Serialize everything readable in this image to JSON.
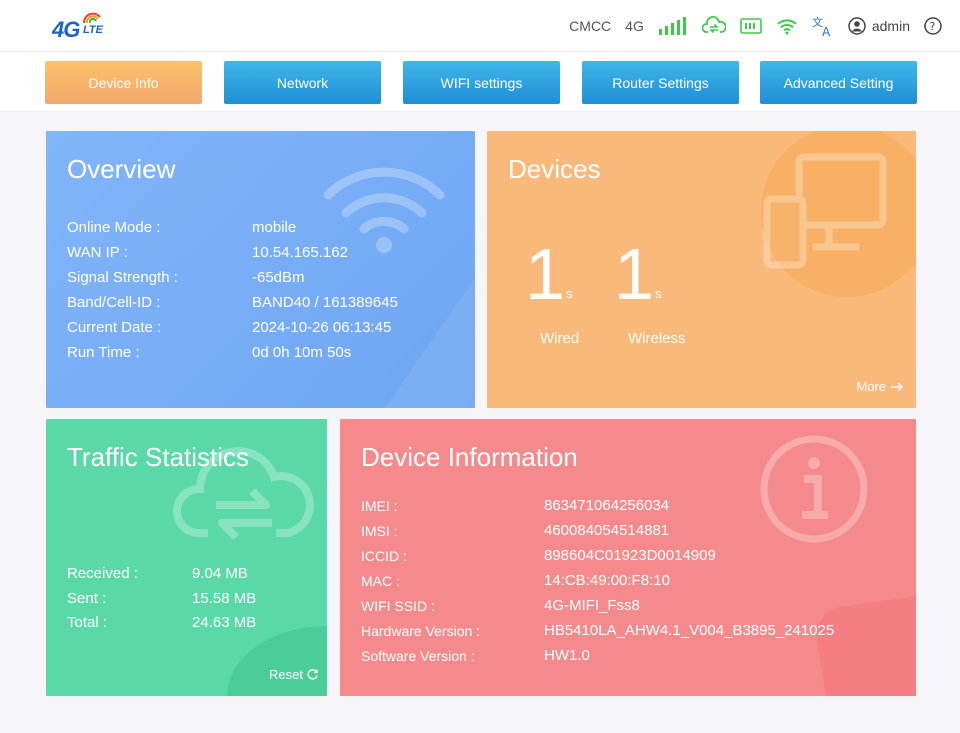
{
  "header": {
    "logo_main": "4G",
    "logo_sub": "LTE",
    "operator": "CMCC",
    "network_type": "4G",
    "icons": [
      "signal-icon",
      "cloud-sync-icon",
      "sim-card-icon",
      "wifi-icon",
      "translate-icon",
      "user-icon",
      "help-icon"
    ],
    "user": "admin",
    "colors": {
      "status_green": "#3ec84a",
      "translate_blue": "#2f6fd6"
    }
  },
  "nav": {
    "tabs": [
      {
        "label": "Device Info",
        "active": true
      },
      {
        "label": "Network",
        "active": false
      },
      {
        "label": "WIFI settings",
        "active": false
      },
      {
        "label": "Router Settings",
        "active": false
      },
      {
        "label": "Advanced Setting",
        "active": false
      }
    ]
  },
  "overview": {
    "title": "Overview",
    "rows": [
      {
        "label": "Online Mode :",
        "value": "mobile"
      },
      {
        "label": "WAN IP :",
        "value": "10.54.165.162"
      },
      {
        "label": "Signal Strength :",
        "value": "-65dBm"
      },
      {
        "label": "Band/Cell-ID :",
        "value": "BAND40 / 161389645"
      },
      {
        "label": "Current Date :",
        "value": "2024-10-26 06:13:45"
      },
      {
        "label": "Run Time :",
        "value": "0d 0h 10m 50s"
      }
    ]
  },
  "devices": {
    "title": "Devices",
    "wired_count": "1",
    "wired_unit": "s",
    "wired_label": "Wired",
    "wireless_count": "1",
    "wireless_unit": "s",
    "wireless_label": "Wireless",
    "more_label": "More"
  },
  "traffic": {
    "title": "Traffic Statistics",
    "rows": [
      {
        "label": "Received :",
        "value": "9.04 MB"
      },
      {
        "label": "Sent :",
        "value": "15.58 MB"
      },
      {
        "label": "Total :",
        "value": "24.63 MB"
      }
    ],
    "reset_label": "Reset"
  },
  "device_info": {
    "title": "Device Information",
    "rows": [
      {
        "label": "IMEI :",
        "value": "863471064256034"
      },
      {
        "label": "IMSI :",
        "value": "460084054514881"
      },
      {
        "label": "ICCID :",
        "value": "898604C01923D0014909"
      },
      {
        "label": "MAC :",
        "value": "14:CB:49:00:F8:10"
      },
      {
        "label": "WIFI SSID :",
        "value": "4G-MIFI_Fss8"
      },
      {
        "label": "Hardware Version :",
        "value": "HB5410LA_AHW4.1_V004_B3895_241025"
      },
      {
        "label": "Software Version :",
        "value": "HW1.0"
      }
    ]
  },
  "card_colors": {
    "overview": "#7db1f7",
    "devices": "#f9b97b",
    "traffic": "#5bd8a8",
    "device_info": "#f58a8c"
  }
}
